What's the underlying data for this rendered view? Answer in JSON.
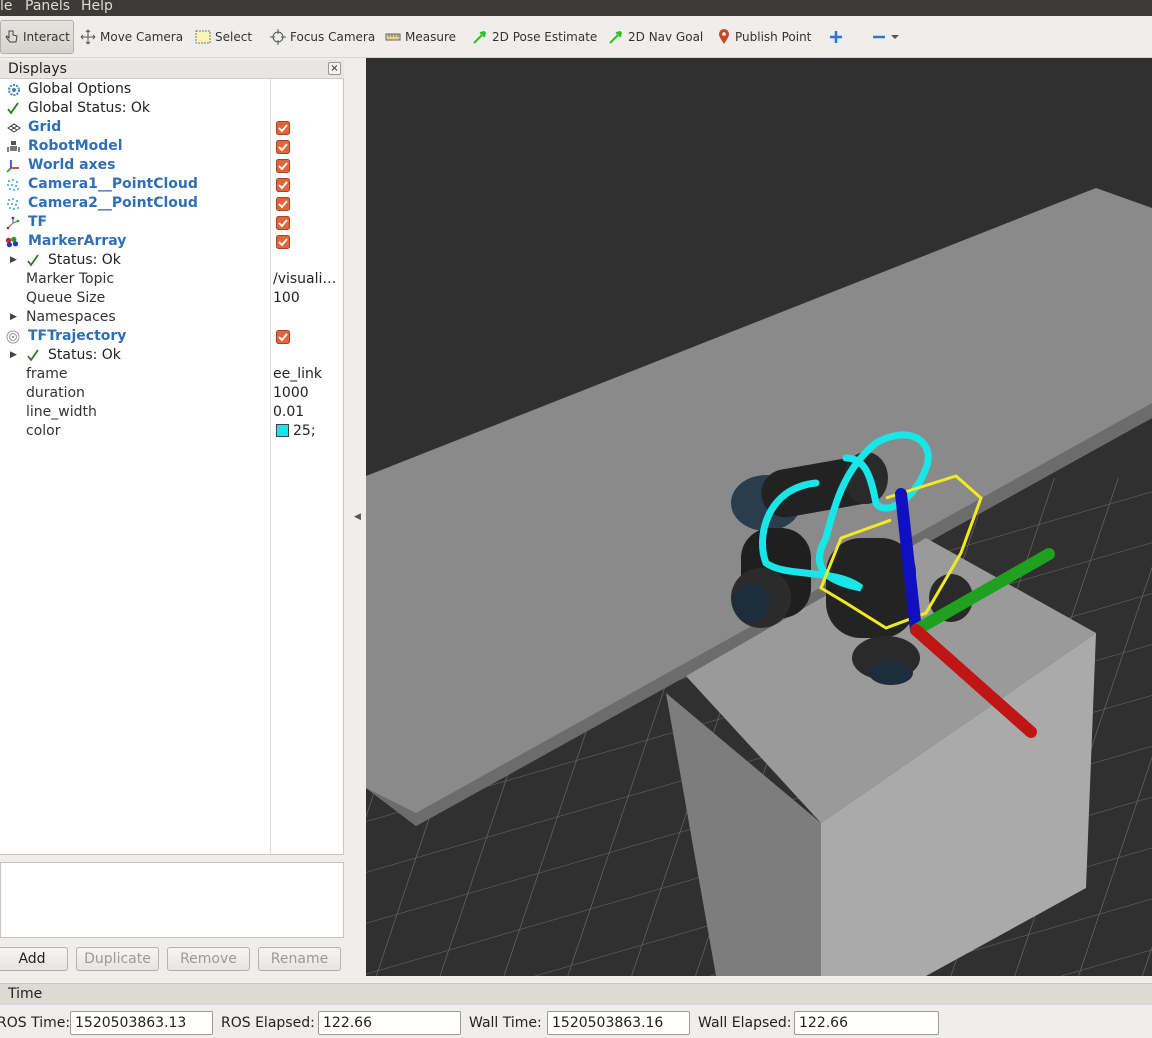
{
  "menu": {
    "file": "le",
    "panels": "Panels",
    "help": "Help"
  },
  "toolbar": {
    "interact": "Interact",
    "move_camera": "Move Camera",
    "select": "Select",
    "focus_camera": "Focus Camera",
    "measure": "Measure",
    "pose_estimate": "2D Pose Estimate",
    "nav_goal": "2D Nav Goal",
    "publish_point": "Publish Point"
  },
  "displays": {
    "title": "Displays",
    "close": "×",
    "rows": {
      "global_options": "Global Options",
      "global_status": "Global Status: Ok",
      "grid": "Grid",
      "robot_model": "RobotModel",
      "world_axes": "World axes",
      "camera1": "Camera1__PointCloud",
      "camera2": "Camera2__PointCloud",
      "tf": "TF",
      "marker_array": "MarkerArray",
      "ma_status": "Status: Ok",
      "marker_topic_label": "Marker Topic",
      "marker_topic_value": "/visuali…",
      "queue_size_label": "Queue Size",
      "queue_size_value": "100",
      "namespaces": "Namespaces",
      "tf_trajectory": "TFTrajectory",
      "tft_status": "Status: Ok",
      "frame_label": "frame",
      "frame_value": "ee_link",
      "duration_label": "duration",
      "duration_value": "1000",
      "line_width_label": "line_width",
      "line_width_value": "0.01",
      "color_label": "color",
      "color_value": "25;"
    },
    "buttons": {
      "add": "Add",
      "duplicate": "Duplicate",
      "remove": "Remove",
      "rename": "Rename"
    }
  },
  "time": {
    "title": "Time",
    "ros_time_label": "ROS Time:",
    "ros_time": "1520503863.13",
    "ros_elapsed_label": "ROS Elapsed:",
    "ros_elapsed": "122.66",
    "wall_time_label": "Wall Time:",
    "wall_time": "1520503863.16",
    "wall_elapsed_label": "Wall Elapsed:",
    "wall_elapsed": "122.66"
  },
  "colors": {
    "accent_blue": "#2f6fb5",
    "checkbox": "#e0653a",
    "trajectory": "#19e6e6",
    "marker_lines": "#f2ea20"
  }
}
